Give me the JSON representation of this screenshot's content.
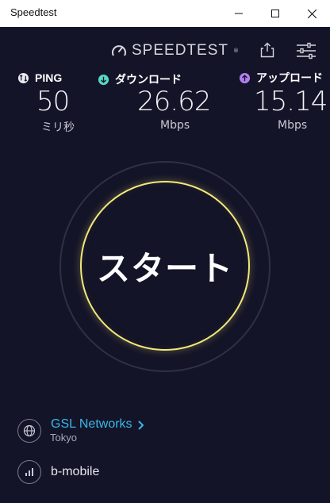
{
  "window": {
    "title": "Speedtest"
  },
  "header": {
    "logo_text": "SPEEDTEST",
    "logo_mark": "®",
    "share_icon": "share-icon",
    "settings_icon": "settings-icon"
  },
  "metrics": {
    "ping": {
      "label": "PING",
      "value": "50",
      "unit": "ミリ秒",
      "icon": "ping-icon",
      "color": "#e8e8ef"
    },
    "download": {
      "label": "ダウンロード",
      "value": "26.62",
      "unit": "Mbps",
      "icon": "download-icon",
      "color": "#56d8c4"
    },
    "upload": {
      "label": "アップロード",
      "value": "15.14",
      "unit": "Mbps",
      "icon": "upload-icon",
      "color": "#b07ff0"
    }
  },
  "main": {
    "start_label": "スタート",
    "start_ring_color": "#f3e97a"
  },
  "server": {
    "name": "GSL Networks",
    "location": "Tokyo",
    "icon": "globe-icon",
    "chevron_icon": "chevron-right-icon",
    "color": "#39b7e8"
  },
  "connection": {
    "carrier": "b-mobile",
    "icon": "signal-icon"
  }
}
